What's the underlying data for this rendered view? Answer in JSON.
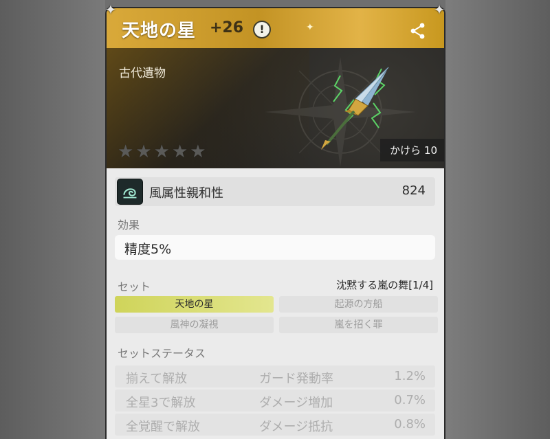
{
  "item": {
    "title": "天地の星",
    "plus": "+26",
    "info_icon": "!",
    "category": "古代遺物",
    "stars_total": 5,
    "stars_filled": 0,
    "kakera_label": "かけら 10"
  },
  "attribute": {
    "label": "風属性親和性",
    "value": "824"
  },
  "effect": {
    "section_label": "効果",
    "text": "精度5%"
  },
  "set": {
    "section_label": "セット",
    "name": "沈黙する嵐の舞[1/4]",
    "items": [
      {
        "label": "天地の星",
        "active": true
      },
      {
        "label": "起源の方船",
        "active": false
      },
      {
        "label": "風神の凝視",
        "active": false
      },
      {
        "label": "嵐を招く罪",
        "active": false
      }
    ]
  },
  "set_status": {
    "section_label": "セットステータス",
    "rows": [
      {
        "condition": "揃えて解放",
        "stat": "ガード発動率",
        "value": "1.2%"
      },
      {
        "condition": "全星3で解放",
        "stat": "ダメージ増加",
        "value": "0.7%"
      },
      {
        "condition": "全覚醒で解放",
        "stat": "ダメージ抵抗",
        "value": "0.8%"
      }
    ]
  },
  "colors": {
    "gold": "#d4a530",
    "active_set": "#d6da6a",
    "weapon_glow": "#4fe05a"
  },
  "icons": {
    "info": "exclamation-circle-icon",
    "share": "share-icon",
    "attribute": "wind-element-icon",
    "star": "star-icon"
  }
}
